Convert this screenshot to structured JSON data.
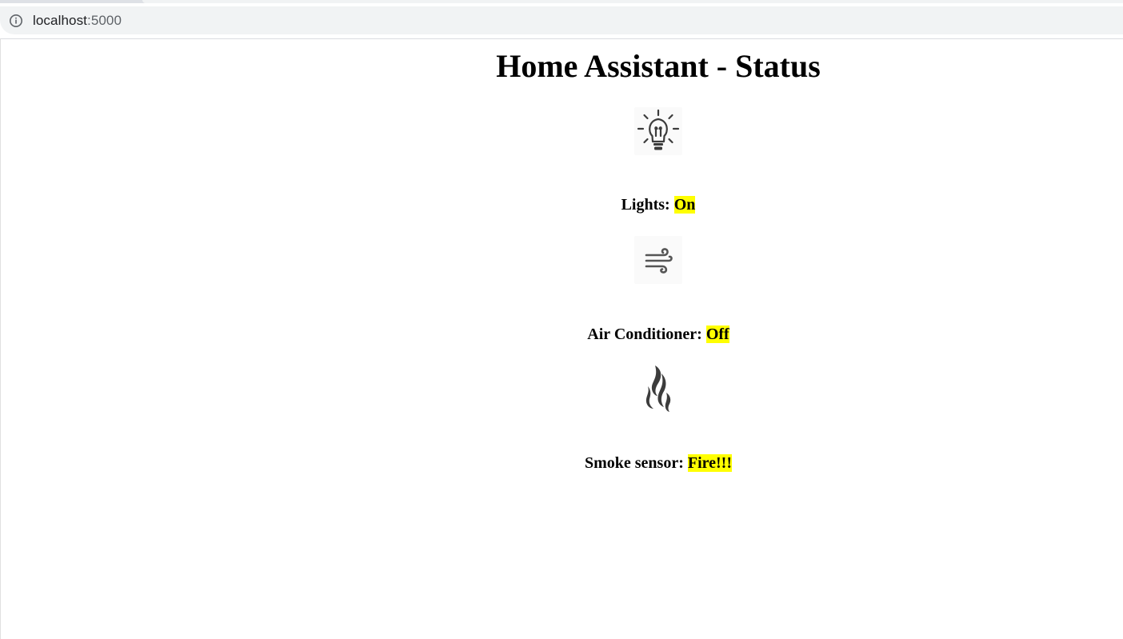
{
  "browser": {
    "url_host": "localhost",
    "url_port": ":5000"
  },
  "page": {
    "title": "Home Assistant - Status"
  },
  "devices": [
    {
      "label": "Lights: ",
      "value": "On",
      "icon": "lightbulb-icon"
    },
    {
      "label": "Air Conditioner: ",
      "value": "Off",
      "icon": "wind-icon"
    },
    {
      "label": "Smoke sensor: ",
      "value": "Fire!!!",
      "icon": "smoke-icon"
    }
  ],
  "colors": {
    "highlight": "#ffff00",
    "icon": "#3c3c3c"
  }
}
